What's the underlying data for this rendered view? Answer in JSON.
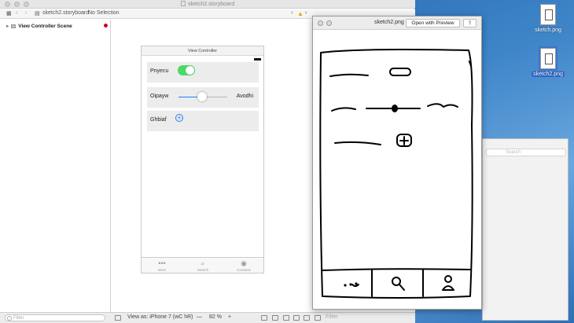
{
  "xcode": {
    "title": "sketch2.storyboard",
    "breadcrumb": {
      "file": "sketch2.storyboard",
      "selection": "No Selection"
    },
    "outline": {
      "scene": "View Controller Scene"
    },
    "storyboard": {
      "vc_title": "View Controller",
      "rows": [
        {
          "label": "Pnyecu",
          "control": "switch",
          "on": true
        },
        {
          "label": "Oipayw",
          "control": "slider",
          "value": 0.5,
          "right_label": "Avodhi"
        },
        {
          "label": "Ghbiaf",
          "control": "add-button"
        }
      ],
      "tabs": [
        {
          "label": "More",
          "icon": "more-icon"
        },
        {
          "label": "Search",
          "icon": "search-icon"
        },
        {
          "label": "Contacts",
          "icon": "contacts-icon"
        }
      ]
    },
    "bottom": {
      "filter_placeholder": "Filter",
      "view_as": "View as: iPhone 7 (wC hR)",
      "zoom_minus": "—",
      "zoom": "82 %",
      "zoom_plus": "+",
      "filter2_placeholder": "Filter"
    },
    "accent_color": "#1a82fb",
    "switch_color": "#4cd964"
  },
  "preview": {
    "title": "sketch2.png",
    "open_button": "Open with Preview",
    "share_icon": "share-icon"
  },
  "finder": {
    "search_placeholder": "Search"
  },
  "desktop": {
    "icons": [
      {
        "label": "sketch.png",
        "selected": false
      },
      {
        "label": "sketch2.png",
        "selected": true
      }
    ]
  }
}
